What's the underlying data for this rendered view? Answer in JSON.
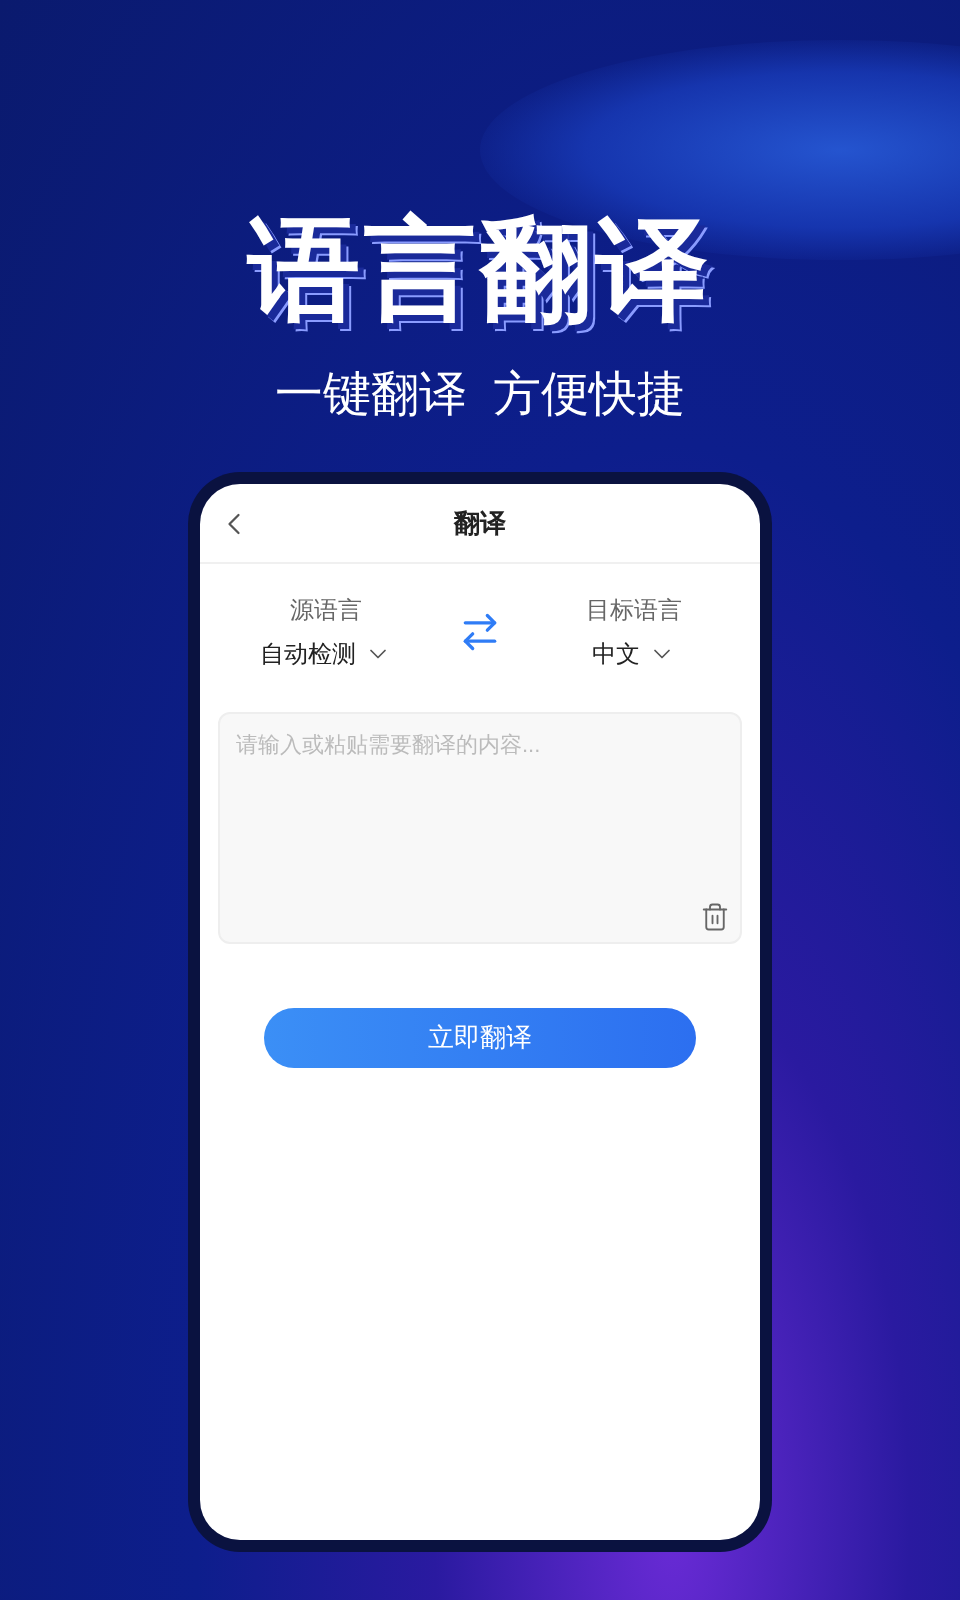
{
  "headline": "语言翻译",
  "subtitle": "一键翻译  方便快捷",
  "screen": {
    "title": "翻译",
    "source": {
      "label": "源语言",
      "value": "自动检测"
    },
    "target": {
      "label": "目标语言",
      "value": "中文"
    },
    "input": {
      "placeholder": "请输入或粘贴需要翻译的内容..."
    },
    "button": "立即翻译"
  }
}
